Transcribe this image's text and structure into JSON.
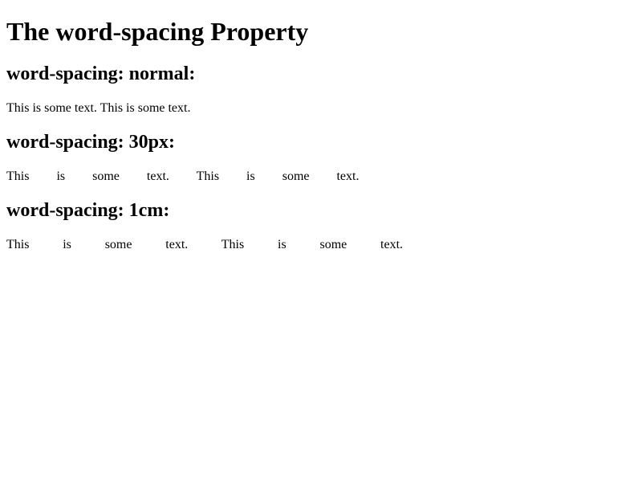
{
  "title": "The word-spacing Property",
  "sections": [
    {
      "heading": "word-spacing: normal:",
      "text": "This is some text. This is some text."
    },
    {
      "heading": "word-spacing: 30px:",
      "text": "This is some text. This is some text."
    },
    {
      "heading": "word-spacing: 1cm:",
      "text": "This is some text. This is some text."
    }
  ]
}
